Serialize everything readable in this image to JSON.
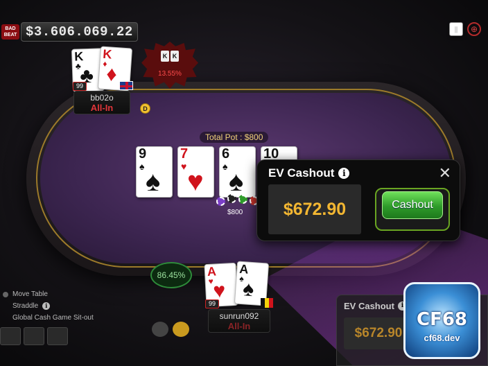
{
  "jackpot": {
    "logo_text": "BAD BEAT",
    "currency": "$",
    "value": "3.606.069.22"
  },
  "top_icons": [
    "chip-icon",
    "chip-red-icon",
    "cards-icon"
  ],
  "opponent": {
    "name": "bb02o",
    "status": "All-In",
    "level": "99",
    "cards": [
      {
        "rank": "K",
        "suit": "♣",
        "color": "black"
      },
      {
        "rank": "K",
        "suit": "♦",
        "color": "red"
      }
    ],
    "equity": "13.55%",
    "mini_cards": [
      "K",
      "K"
    ]
  },
  "dealer_button": "D",
  "pot": {
    "label": "Total Pot : $800",
    "chip_amount": "$800"
  },
  "board": [
    {
      "rank": "9",
      "suit": "♠",
      "color": "black"
    },
    {
      "rank": "7",
      "suit": "♥",
      "color": "red"
    },
    {
      "rank": "6",
      "suit": "♠",
      "color": "black"
    },
    {
      "rank": "10",
      "suit": "♠",
      "color": "black"
    }
  ],
  "hero": {
    "name": "sunrun092",
    "status": "All-In",
    "level": "99",
    "cards": [
      {
        "rank": "A",
        "suit": "♥",
        "color": "red"
      },
      {
        "rank": "A",
        "suit": "♠",
        "color": "black"
      }
    ],
    "equity": "86.45%"
  },
  "ev_popup": {
    "title": "EV Cashout",
    "info": "i",
    "close": "✕",
    "amount": "$672.90",
    "button": "Cashout"
  },
  "ev_ghost": {
    "title": "EV Cashout",
    "info": "i",
    "amount": "$672.90"
  },
  "side_menu": {
    "items": [
      "Move Table",
      "Straddle",
      "Global Cash Game Sit-out"
    ]
  },
  "logo": {
    "text": "CF68",
    "sub": "cf68.dev"
  },
  "colors": {
    "felt": "#3c2550",
    "rim": "#9c7a2a",
    "accent_gold": "#f2b632",
    "cashout_green": "#2e9b2a",
    "allin_red": "#e0353a"
  }
}
